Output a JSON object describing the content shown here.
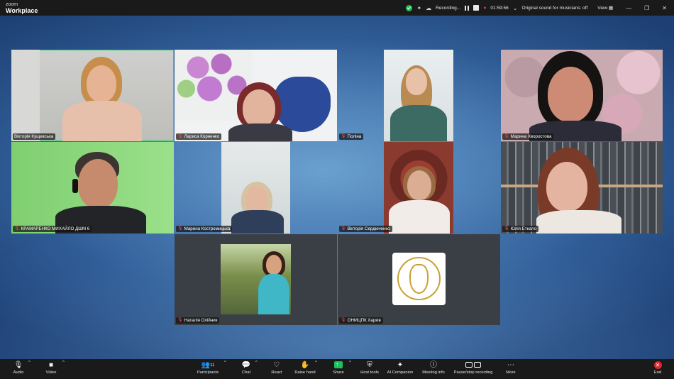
{
  "app": {
    "logo_top": "zoom",
    "logo_bottom": "Workplace"
  },
  "status": {
    "recording_label": "Recording...",
    "timer": "01:59:56",
    "original_sound": "Original sound for musicians: off",
    "view_label": "View"
  },
  "participants": [
    {
      "name": "Вікторія Кущевська",
      "active": true,
      "muted": false
    },
    {
      "name": "Лариса Корненко",
      "active": false,
      "muted": true
    },
    {
      "name": "Поліна",
      "active": false,
      "muted": true
    },
    {
      "name": "Марина Хворостова",
      "active": false,
      "muted": true
    },
    {
      "name": "КРАМАРЕНКО МИХАЙЛО ДШМ 6",
      "active": false,
      "muted": true
    },
    {
      "name": "Марина Костромицька",
      "active": false,
      "muted": true
    },
    {
      "name": "Вікторія Сердюченко",
      "active": false,
      "muted": true
    },
    {
      "name": "Юлія Еткало",
      "active": false,
      "muted": true
    },
    {
      "name": "Наталія Олійник",
      "active": false,
      "muted": true
    },
    {
      "name": "ОНМЦПК Харків",
      "active": false,
      "muted": true
    }
  ],
  "toolbar": {
    "audio": "Audio",
    "video": "Video",
    "participants": "Participants",
    "participants_count": "11",
    "chat": "Chat",
    "react": "React",
    "raise_hand": "Raise hand",
    "share": "Share",
    "host_tools": "Host tools",
    "ai_companion": "AI Companion",
    "meeting_info": "Meeting info",
    "pause_stop": "Pause/stop recording",
    "more": "More",
    "end": "End"
  },
  "colors": {
    "active_speaker": "#2ecc71",
    "muted": "#ff4a4a",
    "share": "#1fbf5a",
    "end": "#d8282f"
  }
}
